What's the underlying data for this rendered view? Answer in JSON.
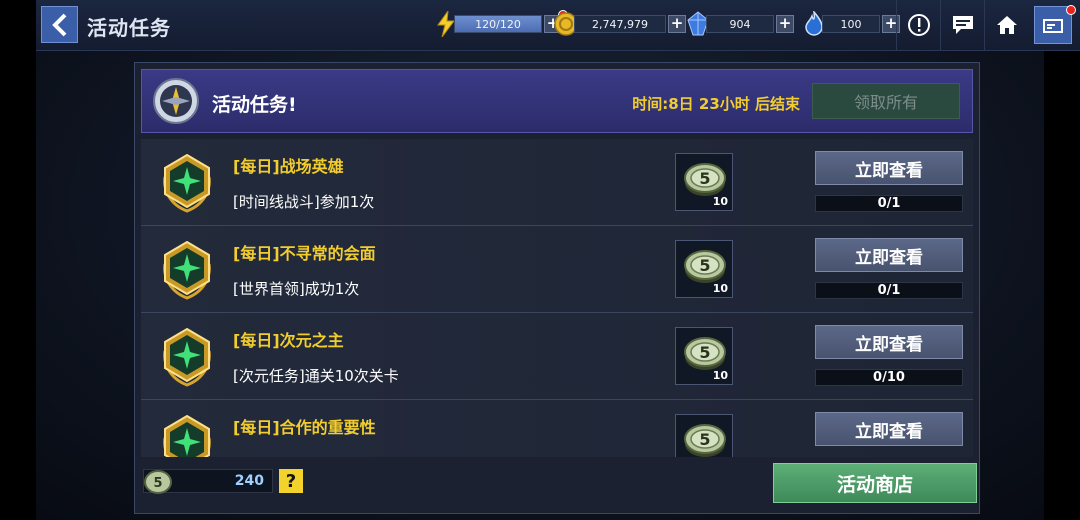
{
  "header": {
    "title": "活动任务",
    "energy": "120/120",
    "gold": "2,747,979",
    "crystals": "904",
    "tickets": "100",
    "plus_label": "+"
  },
  "panel": {
    "title": "活动任务!",
    "time_remaining": "时间:8日 23小时 后结束",
    "claim_all_label": "领取所有"
  },
  "tasks": [
    {
      "title": "[每日]战场英雄",
      "desc": "[时间线战斗]参加1次",
      "reward_qty": "10",
      "button": "立即查看",
      "progress": "0/1",
      "progress_value": 0
    },
    {
      "title": "[每日]不寻常的会面",
      "desc": "[世界首领]成功1次",
      "reward_qty": "10",
      "button": "立即查看",
      "progress": "0/1",
      "progress_value": 0
    },
    {
      "title": "[每日]次元之主",
      "desc": "[次元任务]通关10次关卡",
      "reward_qty": "10",
      "button": "立即查看",
      "progress": "0/10",
      "progress_value": 0
    },
    {
      "title": "[每日]合作的重要性",
      "desc": "",
      "reward_qty": "",
      "button": "立即查看",
      "progress": "",
      "progress_value": 0
    }
  ],
  "footer": {
    "coin_count": "240",
    "help_label": "?",
    "shop_label": "活动商店"
  },
  "colors": {
    "accent_gold": "#f2cd2e",
    "header_purple": "#2c2c6c",
    "shop_green": "#3e8a59",
    "notification_red": "#e8221e"
  },
  "icons": {
    "back": "chevron-left-icon",
    "energy": "lightning-icon",
    "gold": "gold-coin-icon",
    "crystal": "blue-crystal-icon",
    "ticket": "flame-ticket-icon",
    "alert": "exclamation-icon",
    "chat": "chat-icon",
    "home": "home-icon",
    "menu": "menu-icon",
    "emblem": "compass-emblem-icon",
    "medal": "gold-medal-icon",
    "reward": "event-coin-icon"
  }
}
